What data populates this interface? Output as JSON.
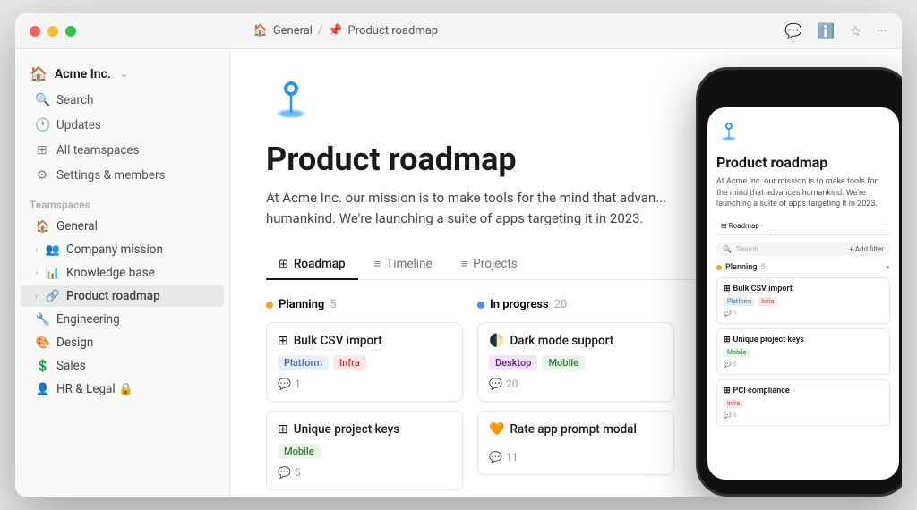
{
  "window": {
    "traffic_lights": [
      "red",
      "yellow",
      "green"
    ],
    "breadcrumb": {
      "parts": [
        "General",
        "Product roadmap"
      ],
      "separator": "/"
    },
    "actions": [
      "💬",
      "ℹ️",
      "☆",
      "···"
    ]
  },
  "sidebar": {
    "workspace": {
      "icon": "🏠",
      "name": "Acme Inc.",
      "chevron": "⌄"
    },
    "nav_items": [
      {
        "icon": "🔍",
        "label": "Search"
      },
      {
        "icon": "🕐",
        "label": "Updates"
      },
      {
        "icon": "▦",
        "label": "All teamspaces"
      },
      {
        "icon": "⚙",
        "label": "Settings & members"
      }
    ],
    "section_title": "Teamspaces",
    "teamspace_items": [
      {
        "icon": "🏠",
        "label": "General",
        "color": "#e74c3c",
        "type": "emoji"
      },
      {
        "icon": "👥",
        "label": "Company mission",
        "chevron": "›",
        "type": "group"
      },
      {
        "icon": "📊",
        "label": "Knowledge base",
        "chevron": "›",
        "type": "group"
      },
      {
        "icon": "🔗",
        "label": "Product roadmap",
        "chevron": "›",
        "active": true,
        "type": "group"
      },
      {
        "icon": "🔧",
        "label": "Engineering",
        "color": "#e67e22",
        "type": "emoji"
      },
      {
        "icon": "🎨",
        "label": "Design",
        "color": "#3498db",
        "type": "emoji"
      },
      {
        "icon": "💲",
        "label": "Sales",
        "color": "#2ecc71",
        "type": "emoji"
      },
      {
        "icon": "👤",
        "label": "HR & Legal 🔒",
        "color": "#9b59b6",
        "type": "emoji"
      }
    ]
  },
  "header": {
    "breadcrumb_general": "General",
    "breadcrumb_page": "Product roadmap",
    "general_icon": "🏠",
    "page_icon_type": "pin"
  },
  "page": {
    "title": "Product roadmap",
    "description": "At Acme Inc. our mission is to make tools for the mind that advan... humankind. We're launching a suite of apps targeting it in 2023.",
    "description_full": "At Acme Inc. our mission is to make tools for the mind that advances humankind. We're launching a suite of apps targeting it in 2023.",
    "tabs": [
      {
        "icon": "▦",
        "label": "Roadmap",
        "active": true
      },
      {
        "icon": "≡",
        "label": "Timeline"
      },
      {
        "icon": "≡",
        "label": "Projects"
      }
    ],
    "columns": [
      {
        "name": "Planning",
        "count": 5,
        "color": "planning",
        "cards": [
          {
            "icon": "▦",
            "title": "Bulk CSV import",
            "tags": [
              {
                "label": "Platform",
                "class": "tag-platform"
              },
              {
                "label": "Infra",
                "class": "tag-infra"
              }
            ],
            "comments": 1
          },
          {
            "icon": "▦",
            "title": "Unique project keys",
            "tags": [
              {
                "label": "Mobile",
                "class": "tag-mobile"
              }
            ],
            "comments": 5
          }
        ]
      },
      {
        "name": "In progress",
        "count": 20,
        "color": "inprogress",
        "cards": [
          {
            "icon": "🌓",
            "title": "Dark mode support",
            "tags": [
              {
                "label": "Desktop",
                "class": "tag-desktop"
              },
              {
                "label": "Mobile",
                "class": "tag-mobile"
              }
            ],
            "comments": 20
          },
          {
            "icon": "🧡",
            "title": "Rate app prompt modal",
            "tags": [],
            "comments": 11
          }
        ]
      }
    ]
  },
  "phone": {
    "title": "Product roadmap",
    "description": "At Acme Inc. our mission is to make tools for the mind that advances humankind. We're launching a suite of apps targeting it in 2023.",
    "tabs": [
      "Roadmap ·",
      "···"
    ],
    "search_placeholder": "Search",
    "filter_label": "+ Add filter",
    "planning_label": "Planning",
    "planning_count": "5",
    "inprogress_dot_color": "#4a90e2",
    "cards_phone": [
      {
        "title": "Bulk CSV import",
        "tags": [
          {
            "label": "Platform",
            "class": "tag-platform"
          },
          {
            "label": "Infra",
            "class": "tag-infra"
          }
        ],
        "comments": "1"
      },
      {
        "title": "Unique project keys",
        "tags": [
          {
            "label": "Mobile",
            "class": "tag-mobile"
          }
        ],
        "comments": "5"
      },
      {
        "title": "PCI compliance",
        "tags": [
          {
            "label": "Infra",
            "class": "tag-infra"
          }
        ],
        "comments": "5"
      }
    ]
  }
}
